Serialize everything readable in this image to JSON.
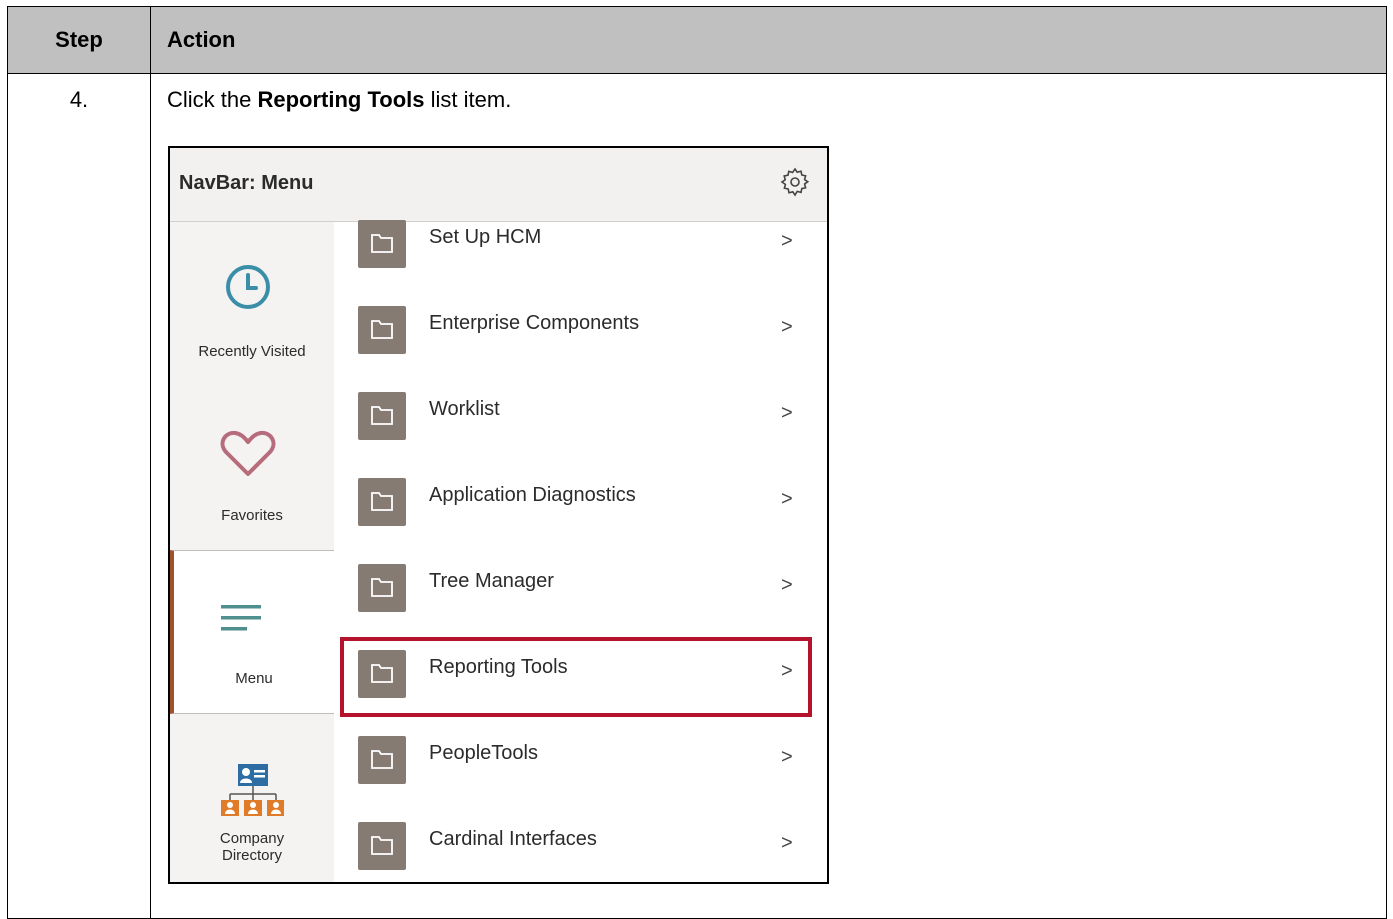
{
  "table": {
    "header_step": "Step",
    "header_action": "Action",
    "step_number": "4.",
    "instruction_prefix": "Click the ",
    "instruction_bold": "Reporting Tools",
    "instruction_suffix": " list item."
  },
  "navbar": {
    "title": "NavBar: Menu",
    "settings_icon": "gear-icon",
    "sidebar": [
      {
        "label": "Recently Visited",
        "icon": "clock-icon"
      },
      {
        "label": "Favorites",
        "icon": "heart-icon"
      },
      {
        "label": "Menu",
        "icon": "menu-lines-icon",
        "active": true
      },
      {
        "label": "Company\nDirectory",
        "icon": "org-chart-icon"
      }
    ],
    "items": [
      {
        "label": "Set Up HCM"
      },
      {
        "label": "Enterprise Components"
      },
      {
        "label": "Worklist"
      },
      {
        "label": "Application Diagnostics"
      },
      {
        "label": "Tree Manager"
      },
      {
        "label": "Reporting Tools",
        "highlighted": true
      },
      {
        "label": "PeopleTools"
      },
      {
        "label": "Cardinal Interfaces"
      }
    ],
    "chevron": ">"
  },
  "colors": {
    "header_bg": "#c0c0c0",
    "folder_icon_bg": "#857b73",
    "highlight_border": "#b5122e",
    "clock_icon": "#3a8ea8",
    "heart_icon": "#b76c7c",
    "menu_icon": "#4f8f8f",
    "directory_icon_blue": "#2e6da4",
    "directory_icon_orange": "#e07b29"
  }
}
